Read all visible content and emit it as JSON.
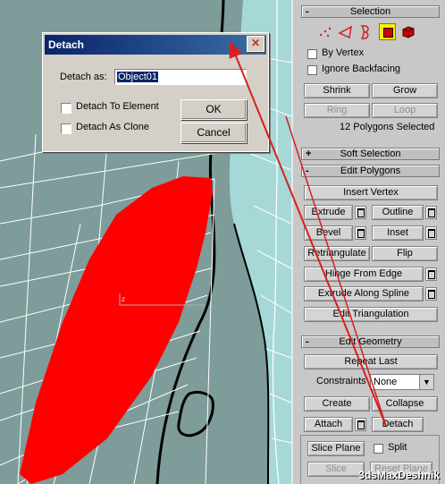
{
  "dialog": {
    "title": "Detach",
    "detach_as_label": "Detach as:",
    "object_name": "Object01",
    "detach_to_element_label": "Detach To Element",
    "detach_as_clone_label": "Detach As Clone",
    "ok_label": "OK",
    "cancel_label": "Cancel",
    "close_glyph": "✕"
  },
  "selection": {
    "header": "Selection",
    "by_vertex_label": "By Vertex",
    "ignore_backfacing_label": "Ignore Backfacing",
    "shrink_label": "Shrink",
    "grow_label": "Grow",
    "ring_label": "Ring",
    "loop_label": "Loop",
    "status": "12 Polygons Selected",
    "sign": "-"
  },
  "soft_selection": {
    "header": "Soft Selection",
    "sign": "+"
  },
  "edit_polygons": {
    "header": "Edit Polygons",
    "sign": "-",
    "insert_vertex_label": "Insert Vertex",
    "extrude_label": "Extrude",
    "outline_label": "Outline",
    "bevel_label": "Bevel",
    "inset_label": "Inset",
    "retriangulate_label": "Retriangulate",
    "flip_label": "Flip",
    "hinge_from_edge_label": "Hinge From Edge",
    "extrude_along_spline_label": "Extrude Along Spline",
    "edit_triangulation_label": "Edit Triangulation"
  },
  "edit_geometry": {
    "header": "Edit Geometry",
    "sign": "-",
    "repeat_last_label": "Repeat Last",
    "constraints_label": "Constraints",
    "constraints_value": "None",
    "create_label": "Create",
    "collapse_label": "Collapse",
    "attach_label": "Attach",
    "detach_label": "Detach",
    "slice_plane_label": "Slice Plane",
    "split_label": "Split",
    "slice_label": "Slice",
    "reset_plane_label": "Reset Plane"
  },
  "watermark": "3dsMaxDeshnik",
  "colors": {
    "selected_polygon": "#ff0000",
    "viewport_bg": "#7d9c9a",
    "mesh_light": "#a6d8d8",
    "arrow": "#d42020",
    "panel_bg": "#c8c8c8"
  }
}
